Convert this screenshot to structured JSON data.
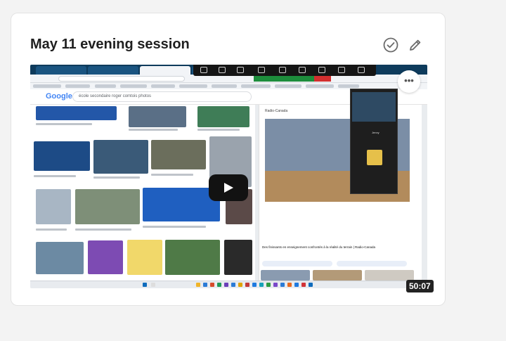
{
  "card": {
    "title": "May 11 evening session",
    "duration": "50:07",
    "more_label": "•••"
  },
  "video": {
    "google_logo": "Google",
    "search_query": "école secondaire roger comtois photos",
    "side_panel_source": "Radio-Canada",
    "side_panel_caption": "Des finissants en enseignement confrontés à la réalité du terrain | Radio-Canada",
    "participant_name": "Jenny"
  },
  "colors": {
    "accent": "#0b57d0",
    "icon_gray": "#6b6b6b",
    "play_bg": "#121212"
  },
  "icons": [
    "check-circle-icon",
    "pencil-icon",
    "play-icon",
    "more-icon"
  ]
}
